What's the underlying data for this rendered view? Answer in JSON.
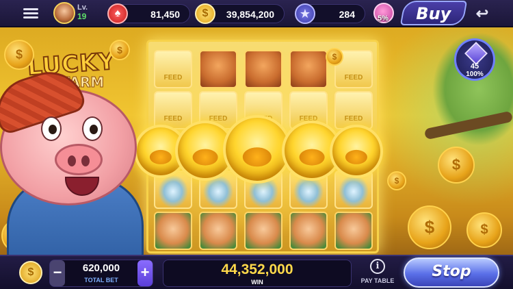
{
  "topbar": {
    "level_label": "Lv.",
    "level_value": "19",
    "chips": "81,450",
    "coins": "39,854,200",
    "stars": "284",
    "piggy_bank_percent": "5%",
    "buy_label": "Buy",
    "icons": {
      "menu": "menu-icon",
      "chips": "poker-chip-icon",
      "coins": "coin-icon",
      "stars": "star-icon",
      "piggy": "piggy-bank-icon",
      "back": "back-arrow-icon"
    }
  },
  "mission": {
    "count": "45",
    "percent": "100%"
  },
  "game": {
    "logo_line1": "LUCKY",
    "logo_line2": "FARM",
    "feed_label": "FEED",
    "coin_symbol": "$"
  },
  "bottombar": {
    "total_bet_value": "620,000",
    "total_bet_label": "TOTAL BET",
    "minus_label": "−",
    "plus_label": "+",
    "win_value": "44,352,000",
    "win_label": "WIN",
    "paytable_label": "PAY TABLE",
    "paytable_icon": "i",
    "stop_label": "Stop"
  },
  "colors": {
    "topbar_bg": "#1b1638",
    "gold": "#ffd94a",
    "accent_blue": "#5a6fe8",
    "level_green": "#5fe06a"
  }
}
